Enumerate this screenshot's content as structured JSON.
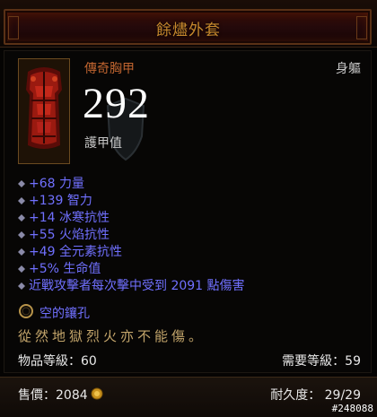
{
  "item": {
    "name": "餘燼外套",
    "type": "傳奇胸甲",
    "slot": "身軀",
    "armor": "292",
    "armor_label": "護甲值"
  },
  "stats": [
    "+68 力量",
    "+139 智力",
    "+14 冰寒抗性",
    "+55 火焰抗性",
    "+49 全元素抗性",
    "+5% 生命值",
    "近戰攻擊者每次擊中受到 2091 點傷害"
  ],
  "socket": "空的鑲孔",
  "flavor": "從然地獄烈火亦不能傷。",
  "item_level": "物品等級：60",
  "required_level": "需要等級：59",
  "price_label": "售價：2084",
  "durability": "耐久度： 29/29",
  "corner_id": "#248088",
  "icons": {
    "armor": "chest-armor-icon",
    "socket": "empty-socket-icon",
    "currency": "gold-coin-icon",
    "stat_bullet": "diamond-bullet-icon"
  },
  "colors": {
    "name": "#c7892d",
    "type": "#bf642f",
    "stat": "#7070ff",
    "flavor": "#c2a46a"
  }
}
